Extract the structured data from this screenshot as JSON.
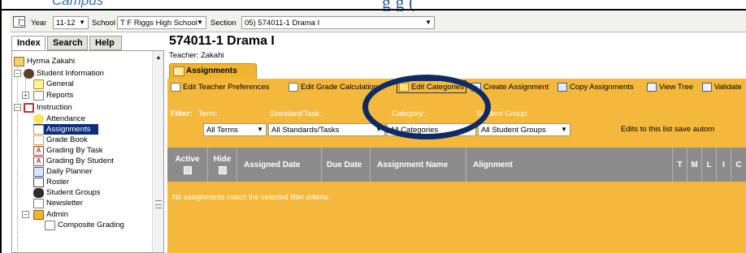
{
  "header": {
    "logo_text": "Campus",
    "title_fragment": "g   g   (   "
  },
  "topbar": {
    "year_label": "Year",
    "year_value": "11-12",
    "school_label": "School",
    "school_value": "T F Riggs High School",
    "section_label": "Section",
    "section_value": "05) 574011-1 Drama I"
  },
  "sidebar": {
    "tabs": [
      "Index",
      "Search",
      "Help"
    ],
    "items": [
      {
        "label": "Hyrma Zakahi",
        "icon": "student-icon"
      },
      {
        "label": "Student Information",
        "icon": "student-info-icon"
      },
      {
        "label": "General",
        "icon": "folder-icon"
      },
      {
        "label": "Reports",
        "icon": "folder-icon"
      },
      {
        "label": "Instruction",
        "icon": "instruction-icon"
      },
      {
        "label": "Attendance",
        "icon": "attendance-icon"
      },
      {
        "label": "Assignments",
        "icon": "assignments-icon"
      },
      {
        "label": "Grade Book",
        "icon": "gradebook-icon"
      },
      {
        "label": "Grading By Task",
        "icon": "grade-a-icon"
      },
      {
        "label": "Grading By Student",
        "icon": "grade-a-icon"
      },
      {
        "label": "Daily Planner",
        "icon": "calendar-icon"
      },
      {
        "label": "Roster",
        "icon": "roster-icon"
      },
      {
        "label": "Student Groups",
        "icon": "groups-icon"
      },
      {
        "label": "Newsletter",
        "icon": "newsletter-icon"
      },
      {
        "label": "Admin",
        "icon": "admin-icon"
      },
      {
        "label": "Composite Grading",
        "icon": "pencil-icon"
      }
    ],
    "selected": "Assignments"
  },
  "main": {
    "course_title": "574011-1 Drama I",
    "teacher_line": "Teacher: Zakahi",
    "tab_label": "Assignments",
    "toolbar": [
      "Edit Teacher Preferences",
      "Edit Grade Calculations",
      "Edit Categories",
      "Create Assignment",
      "Copy Assignments",
      "View Tree",
      "Validate"
    ],
    "filters": {
      "filter_label": "Filter:",
      "term_label": "Term:",
      "term_value": "All Terms",
      "standard_label": "Standard/Task:",
      "standard_value": "All Standards/Tasks",
      "category_label": "Category:",
      "category_value": "All Categories",
      "group_label": "Student Group:",
      "group_value": "All Student Groups",
      "note": "Edits to this list save autom"
    },
    "columns": [
      "Active",
      "Hide",
      "Assigned Date",
      "Due Date",
      "Assignment Name",
      "Alignment",
      "T",
      "M",
      "L",
      "I",
      "C"
    ],
    "empty_message": "No assignments match the selected filter criteria."
  },
  "colors": {
    "accent_yellow": "#f4b83d",
    "selected_nav": "#0d2f7d",
    "grid_header": "#8c8c8c",
    "annotation": "#0f2a66"
  }
}
